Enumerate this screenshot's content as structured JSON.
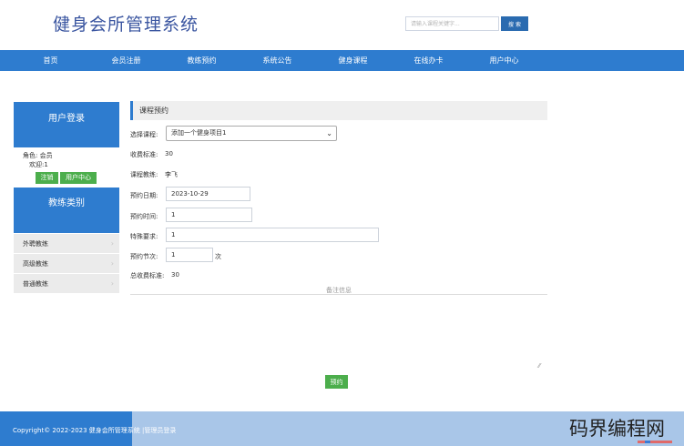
{
  "header": {
    "site_title": "健身会所管理系统",
    "search_placeholder": "请输入课程关键字...",
    "search_button": "搜 索"
  },
  "nav": [
    "首页",
    "会员注册",
    "教练预约",
    "系统公告",
    "健身课程",
    "在线办卡",
    "用户中心"
  ],
  "sidebar": {
    "login_title": "用户登录",
    "role_label": "角色:",
    "role_value": "会员",
    "welcome": "欢迎:1",
    "logout_button": "注销",
    "user_center_button": "用户中心",
    "coach_category_title": "教练类别",
    "coach_categories": [
      "外聘教练",
      "高级教练",
      "普通教练"
    ]
  },
  "form": {
    "section_title": "课程预约",
    "course_label": "选择课程:",
    "course_value": "添加一个健身项目1",
    "fee_label": "收费标准:",
    "fee_value": "30",
    "coach_label": "课程教练:",
    "coach_value": "李飞",
    "date_label": "预约日期:",
    "date_value": "2023-10-29",
    "time_label": "预约时间:",
    "time_value": "1",
    "special_label": "特殊要求:",
    "special_value": "1",
    "sessions_label": "预约节次:",
    "sessions_value": "1",
    "sessions_unit": "次",
    "total_label": "总收费标准:",
    "total_value": "30",
    "remark_title": "备注信息",
    "submit_button": "预约"
  },
  "footer": {
    "copyright": "Copyright© 2022-2023 健身会所管理系统 ",
    "admin_link": "|管理员登录"
  },
  "watermark": "码界编程网"
}
